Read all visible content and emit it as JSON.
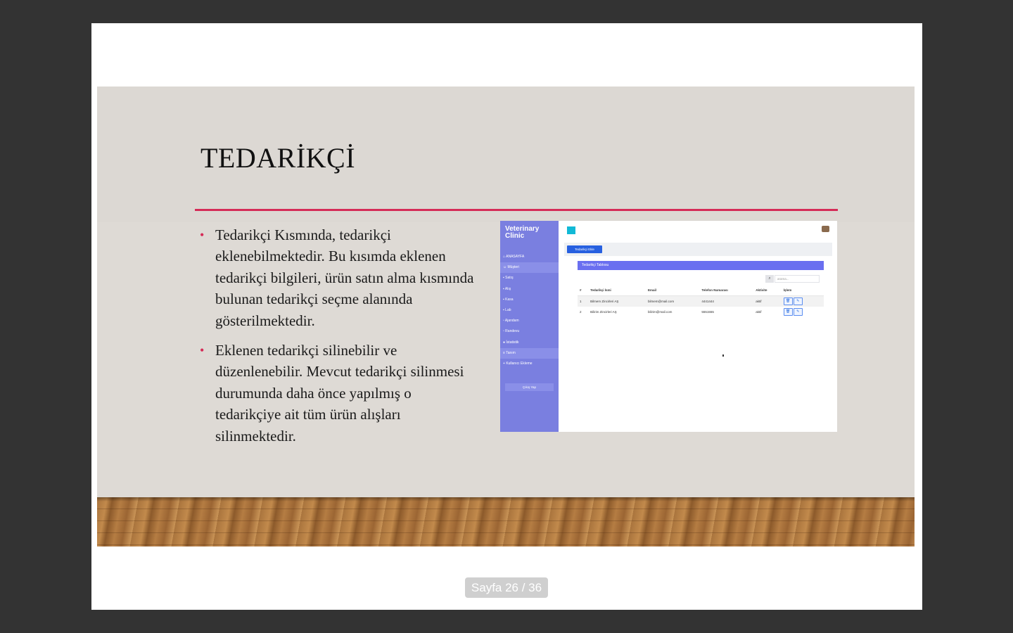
{
  "slide": {
    "title": "TEDARİKÇİ",
    "accent_color": "#d52b57",
    "bullets": [
      "Tedarikçi Kısmında, tedarikçi eklenebilmektedir. Bu kısımda eklenen tedarikçi bilgileri, ürün satın alma kısmında bulunan tedarikçi seçme alanında gösterilmektedir.",
      "Eklenen tedarikçi silinebilir ve düzenlenebilir. Mevcut tedarikçi silinmesi durumunda daha önce yapılmış o tedarikçiye ait tüm ürün alışları silinmektedir."
    ]
  },
  "screenshot": {
    "brand": "Veterinary Clinic",
    "nav": [
      {
        "label": "ANASAYFA",
        "icon": "home-icon"
      },
      {
        "label": "Müşteri",
        "icon": "users-icon"
      },
      {
        "label": "Satış",
        "icon": "cart-icon"
      },
      {
        "label": "Alış",
        "icon": "bag-icon"
      },
      {
        "label": "Kasa",
        "icon": "wallet-icon"
      },
      {
        "label": "Lab",
        "icon": "flask-icon"
      },
      {
        "label": "Ajandam",
        "icon": "calendar-icon"
      },
      {
        "label": "Randevu",
        "icon": "calendar-icon"
      },
      {
        "label": "İstatistik",
        "icon": "chart-icon"
      },
      {
        "label": "Tanım",
        "icon": "list-icon"
      },
      {
        "label": "Kullanıcı Ekleme",
        "icon": "user-plus-icon"
      }
    ],
    "logout": "Çıkış Yap",
    "add_button": "Tedarikçi Ekle",
    "table_title": "Tedarikçi Tablosu",
    "search_placeholder": "arama...",
    "columns": [
      "#",
      "Tedarikçi İsmi",
      "Email",
      "Telefon Numarası",
      "Aktivite",
      "İşlem"
    ],
    "rows": [
      [
        "1",
        "Bilmem Zincirleri AŞ",
        "bilmem@mail.com",
        "4441444",
        "aktif"
      ],
      [
        "2",
        "Bilirim Zincirleri AŞ",
        "bilirim@mail.com",
        "5551555",
        "aktif"
      ]
    ],
    "primary_color": "#7a7fe0"
  },
  "viewer": {
    "page_indicator": "Sayfa 26 / 36"
  }
}
